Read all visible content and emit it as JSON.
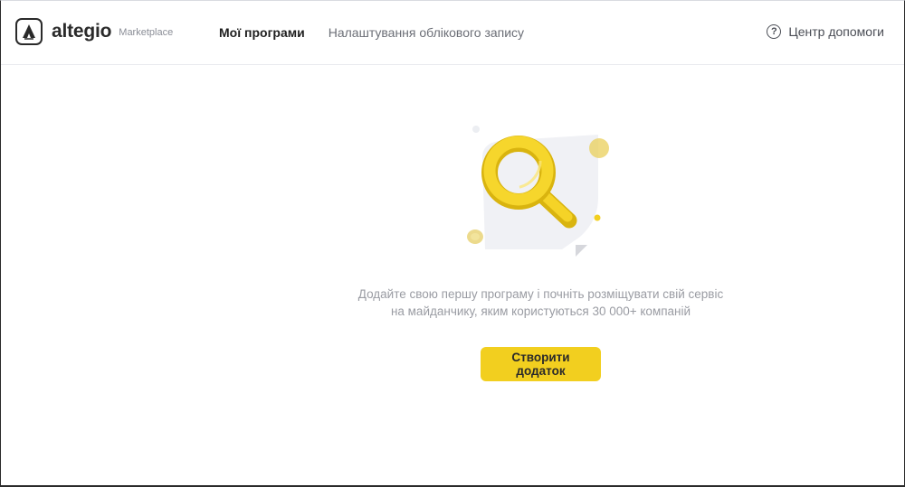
{
  "brand": {
    "name": "altegio",
    "subtitle": "Marketplace"
  },
  "nav": {
    "items": [
      {
        "label": "Мої програми",
        "active": true
      },
      {
        "label": "Налаштування облікового запису",
        "active": false
      }
    ]
  },
  "help": {
    "label": "Центр допомоги",
    "icon": "question-circle-icon"
  },
  "empty_state": {
    "illustration": "magnifier-illustration",
    "line1": "Додайте свою першу програму і почніть розміщувати свій сервіс",
    "line2": "на майданчику, яким користуються 30 000+ компаній",
    "button_label": "Створити додаток"
  },
  "colors": {
    "accent": "#f2cf1f",
    "text_primary": "#1f1f1f",
    "text_muted": "#9a9ca3"
  }
}
